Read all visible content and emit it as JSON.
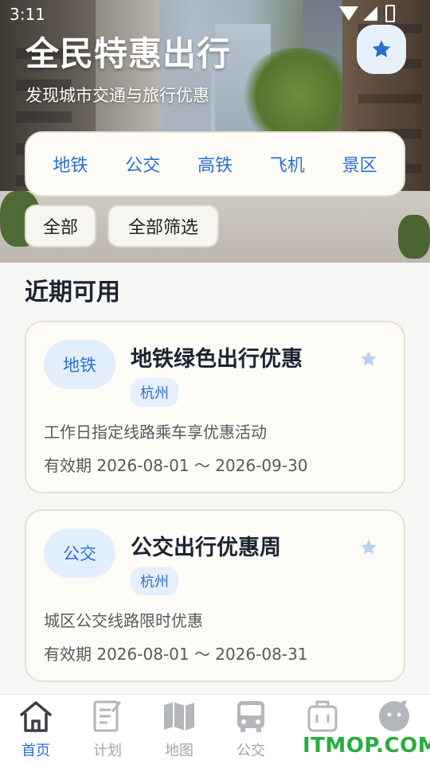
{
  "status_bar": {
    "time": "3:11"
  },
  "hero": {
    "title": "全民特惠出行",
    "subtitle": "发现城市交通与旅行优惠",
    "favorite_icon": "star-icon"
  },
  "categories": [
    "地铁",
    "公交",
    "高铁",
    "飞机",
    "景区"
  ],
  "filters": {
    "all_label": "全部",
    "filter_label": "全部筛选"
  },
  "section": {
    "title": "近期可用"
  },
  "deals": [
    {
      "badge": "地铁",
      "title": "地铁绿色出行优惠",
      "city": "杭州",
      "description": "工作日指定线路乘车享优惠活动",
      "validity": "有效期 2026-08-01 ～ 2026-09-30"
    },
    {
      "badge": "公交",
      "title": "公交出行优惠周",
      "city": "杭州",
      "description": "城区公交线路限时优惠",
      "validity": "有效期 2026-08-01 ～ 2026-08-31"
    }
  ],
  "tabbar": {
    "items": [
      {
        "label": "首页",
        "icon": "home-icon",
        "active": true
      },
      {
        "label": "计划",
        "icon": "notepad-icon",
        "active": false
      },
      {
        "label": "地图",
        "icon": "map-icon",
        "active": false
      },
      {
        "label": "公交",
        "icon": "bus-icon",
        "active": false
      },
      {
        "label": "",
        "icon": "luggage-icon",
        "active": false
      },
      {
        "label": "",
        "icon": "profile-avatar-icon",
        "active": false
      }
    ]
  },
  "watermark": "ITMOP.COM",
  "colors": {
    "accent": "#2b6fd0",
    "star_inactive": "#b9d0f0",
    "tab_inactive": "#a0a4aa"
  }
}
